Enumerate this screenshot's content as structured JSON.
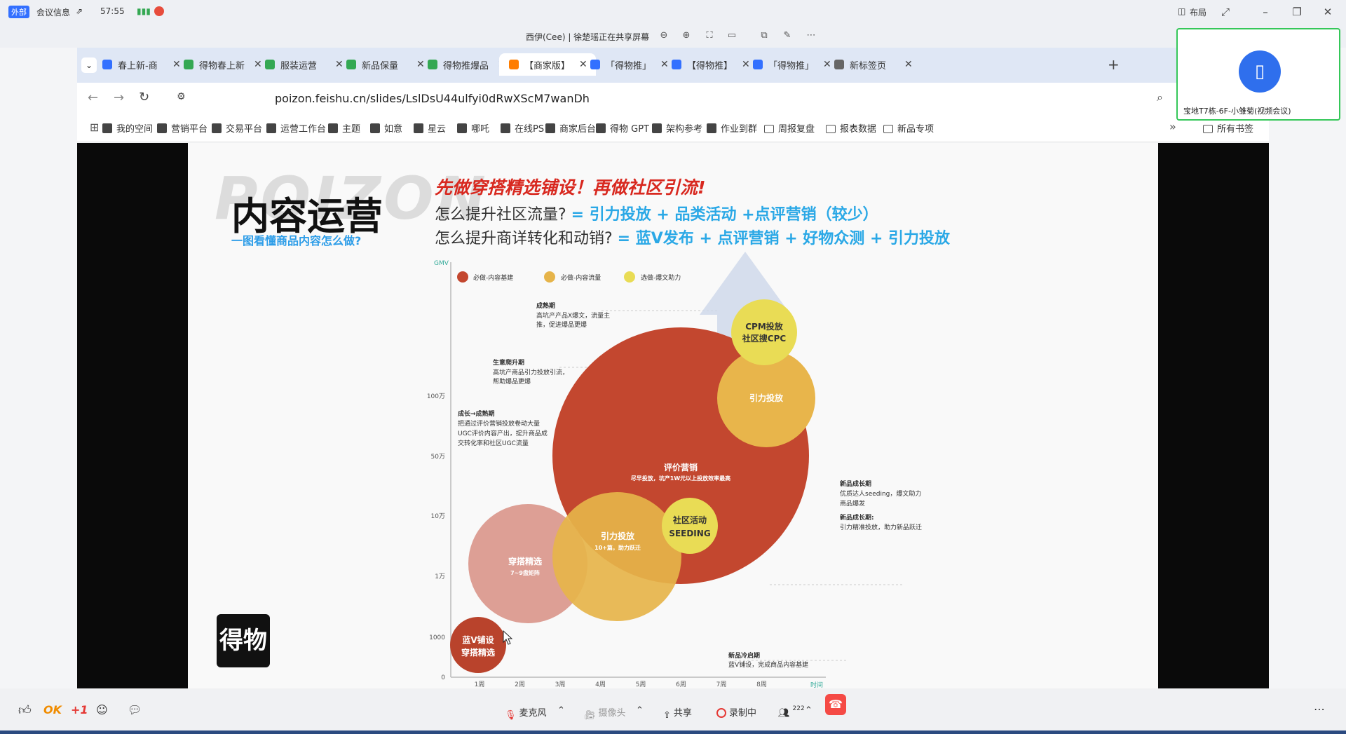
{
  "meeting": {
    "badge": "外部",
    "info_label": "会议信息",
    "time": "57:55",
    "layout_label": "布局",
    "share_title": "西伊(Cee) | 徐楚瑶正在共享屏幕"
  },
  "video_tile": {
    "name": "宝地T7栋-6F-小雏菊(视频会议)"
  },
  "browser": {
    "tabs": [
      {
        "label": "春上新-商",
        "color": "#3370ff"
      },
      {
        "label": "得物春上新",
        "color": "#34a853"
      },
      {
        "label": "服装运营",
        "color": "#34a853"
      },
      {
        "label": "新品保量",
        "color": "#34a853"
      },
      {
        "label": "得物推爆品",
        "color": "#34a853"
      },
      {
        "label": "【商家版】",
        "color": "#ff7d00",
        "active": true
      },
      {
        "label": "「得物推」",
        "color": "#3370ff"
      },
      {
        "label": "【得物推】",
        "color": "#3370ff"
      },
      {
        "label": "「得物推」",
        "color": "#3370ff"
      },
      {
        "label": "新标签页",
        "color": "#666666"
      }
    ],
    "url": "poizon.feishu.cn/slides/LslDsU44ulfyi0dRwXScM7wanDh",
    "bookmarks": [
      "我的空间",
      "营销平台",
      "交易平台",
      "运营工作台",
      "主题",
      "如意",
      "星云",
      "哪吒",
      "在线PS",
      "商家后台",
      "得物 GPT",
      "架构参考",
      "作业到群",
      "周报复盘",
      "报表数据",
      "新品专项"
    ],
    "all_bookmarks": "所有书签"
  },
  "slide": {
    "bg_word": "POIZON",
    "title": "内容运营",
    "subtitle": "一图看懂商品内容怎么做?",
    "headline": "先做穿搭精选铺设！再做社区引流!",
    "q1_prefix": "怎么提升社区流量? ",
    "q1_answer": "= 引力投放 + 品类活动 +点评营销（较少）",
    "q2_prefix": "怎么提升商详转化和动销? ",
    "q2_answer": "= 蓝V发布 + 点评营销 + 好物众测 + 引力投放",
    "logo": "得物",
    "chart": {
      "y_axis_label": "GMV",
      "x_axis_label": "时间",
      "y_ticks": [
        "0",
        "1000",
        "1万",
        "10万",
        "50万",
        "100万"
      ],
      "x_ticks": [
        "1周",
        "2周",
        "3周",
        "4周",
        "5周",
        "6周",
        "7周",
        "8周"
      ],
      "legend": [
        {
          "label": "必做-内容基建",
          "color": "#c3472f"
        },
        {
          "label": "必做-内容流量",
          "color": "#e6b44a"
        },
        {
          "label": "选做-爆文助力",
          "color": "#e9dc55"
        }
      ],
      "bubbles": {
        "blue_v_1": "蓝V铺设",
        "blue_v_2": "穿搭精选",
        "outfit_1": "穿搭精选",
        "outfit_2": "7~9盘矩阵",
        "gravity_small_1": "引力投放",
        "gravity_small_2": "10+篇，助力跃迁",
        "community_1": "社区活动",
        "community_2": "SEEDING",
        "review_1": "评价营销",
        "review_2": "尽早投放，坑产1W元以上投放效率最高",
        "gravity_big": "引力投放",
        "cpm_1": "CPM投放",
        "cpm_2": "社区搜CPC"
      },
      "annotations": {
        "mature_title": "成熟期",
        "mature_1": "高坑产产品X爆文，流量主",
        "mature_2": "推，促进爆品更爆",
        "growth_title": "生意爬升期",
        "growth_1": "高坑产商品引力投放引流，",
        "growth_2": "帮助爆品更爆",
        "g2m_title": "成长→成熟期",
        "g2m_1": "把通过评价营销投放卷动大量",
        "g2m_2": "UGC评价内容产出，提升商品成",
        "g2m_3": "交转化率和社区UGC流量",
        "newgrow_title": "新品成长期",
        "newgrow_1": "优质达人seeding，爆文助力",
        "newgrow_2": "商品爆发",
        "newgrow2_title": "新品成长期:",
        "newgrow2_1": "引力精准投放，助力新品跃迁",
        "cold_title": "新品冷启期",
        "cold_1": "蓝V铺设，完成商品内容基建"
      }
    }
  },
  "controls": {
    "mic": "麦克风",
    "camera": "摄像头",
    "share": "共享",
    "record": "录制中",
    "participants": "222",
    "ok": "OK",
    "plus_one": "+1"
  },
  "colors": {
    "accent_blue": "#2aa8e6",
    "headline_red": "#d8281f",
    "base_red": "#c3472f",
    "flow_orange": "#e6b44a",
    "boost_yellow": "#e9dc55"
  }
}
